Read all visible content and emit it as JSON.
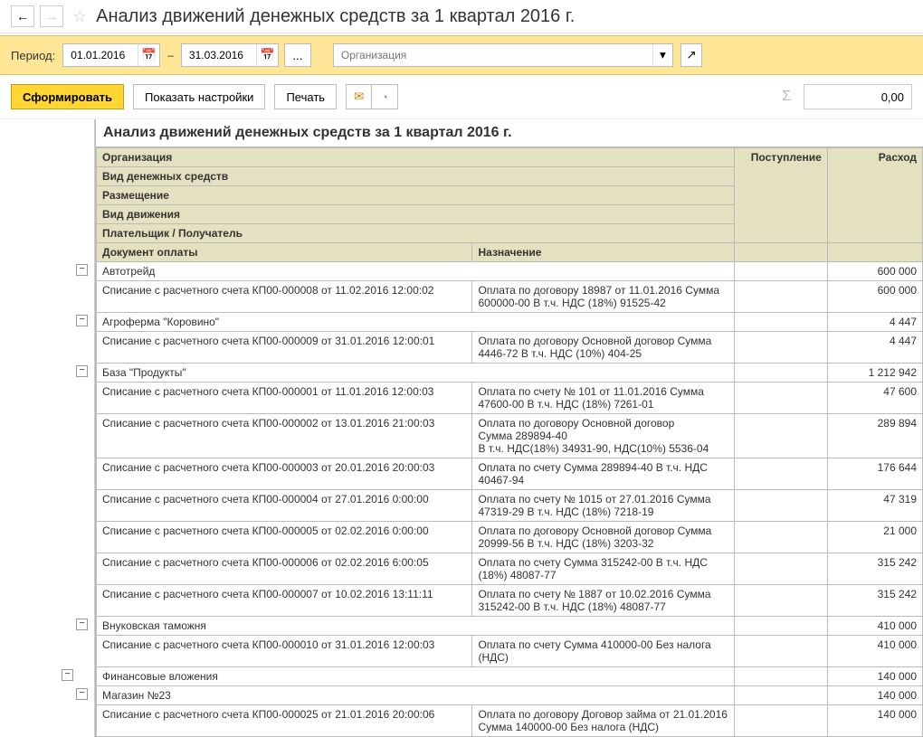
{
  "page": {
    "title": "Анализ движений денежных средств за 1 квартал 2016 г."
  },
  "period": {
    "label": "Период:",
    "from": "01.01.2016",
    "to": "31.03.2016",
    "org_placeholder": "Организация"
  },
  "toolbar": {
    "form": "Сформировать",
    "settings": "Показать настройки",
    "print": "Печать",
    "sum": "0,00"
  },
  "report": {
    "title": "Анализ движений денежных средств за 1 квартал 2016 г.",
    "headers": {
      "org": "Организация",
      "cash_type": "Вид денежных средств",
      "placement": "Размещение",
      "move_type": "Вид движения",
      "payer": "Плательщик / Получатель",
      "doc": "Документ оплаты",
      "purpose": "Назначение",
      "income": "Поступление",
      "expense": "Расход"
    },
    "rows": [
      {
        "lvl": 0,
        "doc": "Автотрейд",
        "exp": "600 000"
      },
      {
        "lvl": 1,
        "doc": "Списание с расчетного счета КП00-000008 от 11.02.2016 12:00:02",
        "purpose": "Оплата по договору 18987 от 11.01.2016 Сумма 600000-00 В т.ч. НДС  (18%) 91525-42",
        "exp": "600 000"
      },
      {
        "lvl": 0,
        "doc": "Агроферма \"Коровино\"",
        "exp": "4 447"
      },
      {
        "lvl": 1,
        "doc": "Списание с расчетного счета КП00-000009 от 31.01.2016 12:00:01",
        "purpose": "Оплата по договору Основной договор Сумма 4446-72 В т.ч. НДС  (10%) 404-25",
        "exp": "4 447"
      },
      {
        "lvl": 0,
        "doc": "База \"Продукты\"",
        "exp": "1 212 942"
      },
      {
        "lvl": 1,
        "doc": "Списание с расчетного счета КП00-000001 от 11.01.2016 12:00:03",
        "purpose": "Оплата по счету № 101 от 11.01.2016 Сумма 47600-00 В т.ч. НДС  (18%) 7261-01",
        "exp": "47 600"
      },
      {
        "lvl": 1,
        "doc": "Списание с расчетного счета КП00-000002 от 13.01.2016 21:00:03",
        "purpose": "Оплата по договору Основной договор\nСумма 289894-40\nВ т.ч. НДС(18%) 34931-90, НДС(10%) 5536-04",
        "exp": "289 894"
      },
      {
        "lvl": 1,
        "doc": "Списание с расчетного счета КП00-000003 от 20.01.2016 20:00:03",
        "purpose": "Оплата по счету Сумма 289894-40 В т.ч. НДС 40467-94",
        "exp": "176 644"
      },
      {
        "lvl": 1,
        "doc": "Списание с расчетного счета КП00-000004 от 27.01.2016 0:00:00",
        "purpose": "Оплата по счету № 1015 от 27.01.2016 Сумма 47319-29 В т.ч. НДС  (18%) 7218-19",
        "exp": "47 319"
      },
      {
        "lvl": 1,
        "doc": "Списание с расчетного счета КП00-000005 от 02.02.2016 0:00:00",
        "purpose": "Оплата по договору Основной договор Сумма 20999-56 В т.ч. НДС  (18%) 3203-32",
        "exp": "21 000"
      },
      {
        "lvl": 1,
        "doc": "Списание с расчетного счета КП00-000006 от 02.02.2016 6:00:05",
        "purpose": "Оплата по счету Сумма 315242-00 В т.ч. НДС  (18%) 48087-77",
        "exp": "315 242"
      },
      {
        "lvl": 1,
        "doc": "Списание с расчетного счета КП00-000007 от 10.02.2016 13:11:11",
        "purpose": "Оплата по счету № 1887 от 10.02.2016 Сумма 315242-00 В т.ч. НДС  (18%) 48087-77",
        "exp": "315 242"
      },
      {
        "lvl": 0,
        "doc": "Внуковская таможня",
        "exp": "410 000"
      },
      {
        "lvl": 1,
        "doc": "Списание с расчетного счета КП00-000010 от 31.01.2016 12:00:03",
        "purpose": "Оплата по счету Сумма 410000-00 Без налога (НДС)",
        "exp": "410 000"
      },
      {
        "lvl": -1,
        "doc": "Финансовые вложения",
        "exp": "140 000"
      },
      {
        "lvl": 0,
        "doc": "Магазин №23",
        "exp": "140 000"
      },
      {
        "lvl": 1,
        "doc": "Списание с расчетного счета КП00-000025 от 21.01.2016 20:00:06",
        "purpose": "Оплата по договору Договор займа от 21.01.2016 Сумма 140000-00 Без налога (НДС)",
        "exp": "140 000"
      }
    ]
  }
}
